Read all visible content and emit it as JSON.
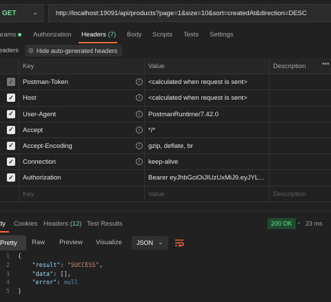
{
  "request": {
    "method": "GET",
    "url": "http://localhost:19091/api/products?page=1&size=10&sort=createdAt&direction=DESC"
  },
  "request_tabs": [
    {
      "label": "arams",
      "dot": true
    },
    {
      "label": "Authorization"
    },
    {
      "label": "Headers ",
      "count": "(7)",
      "active": true
    },
    {
      "label": "Body"
    },
    {
      "label": "Scripts"
    },
    {
      "label": "Tests"
    },
    {
      "label": "Settings"
    }
  ],
  "subheader": {
    "label": "eaders",
    "hide_button": "Hide auto-generated headers"
  },
  "headers_table": {
    "columns": [
      "Key",
      "Value",
      "Description"
    ],
    "more": "•••",
    "rows": [
      {
        "key": "Postman-Token",
        "value": "<calculated when request is sent>",
        "dim": true,
        "info": true
      },
      {
        "key": "Host",
        "value": "<calculated when request is sent>",
        "info": true
      },
      {
        "key": "User-Agent",
        "value": "PostmanRuntime/7.42.0",
        "info": true
      },
      {
        "key": "Accept",
        "value": "*/*",
        "info": true
      },
      {
        "key": "Accept-Encoding",
        "value": "gzip, deflate, br",
        "info": true
      },
      {
        "key": "Connection",
        "value": "keep-alive",
        "info": true
      },
      {
        "key": "Authorization",
        "value": "Bearer eyJhbGciOiJIUzUxMiJ9.eyJYLVVT...",
        "info": false
      }
    ],
    "placeholder": {
      "key": "Key",
      "value": "Value",
      "description": "Description"
    }
  },
  "response_tabs": [
    {
      "label": "dy",
      "active": true
    },
    {
      "label": "Cookies"
    },
    {
      "label": "Headers ",
      "count": "(12)"
    },
    {
      "label": "Test Results"
    }
  ],
  "response_meta": {
    "status": "200 OK",
    "sep": "•",
    "time": "23 ms"
  },
  "format_bar": {
    "options": [
      "Pretty",
      "Raw",
      "Preview",
      "Visualize"
    ],
    "selected": "Pretty",
    "language": "JSON"
  },
  "response_body": {
    "lines": [
      "1",
      "2",
      "3",
      "4",
      "5"
    ],
    "open": "{",
    "close": "}",
    "result_key": "\"result\"",
    "result_val": "\"SUCCESS\"",
    "data_key": "\"data\"",
    "data_val": "[]",
    "error_key": "\"error\"",
    "error_val": "null"
  },
  "colors": {
    "accent": "#ff6c37",
    "success": "#6bdd9a",
    "background": "#212121"
  }
}
